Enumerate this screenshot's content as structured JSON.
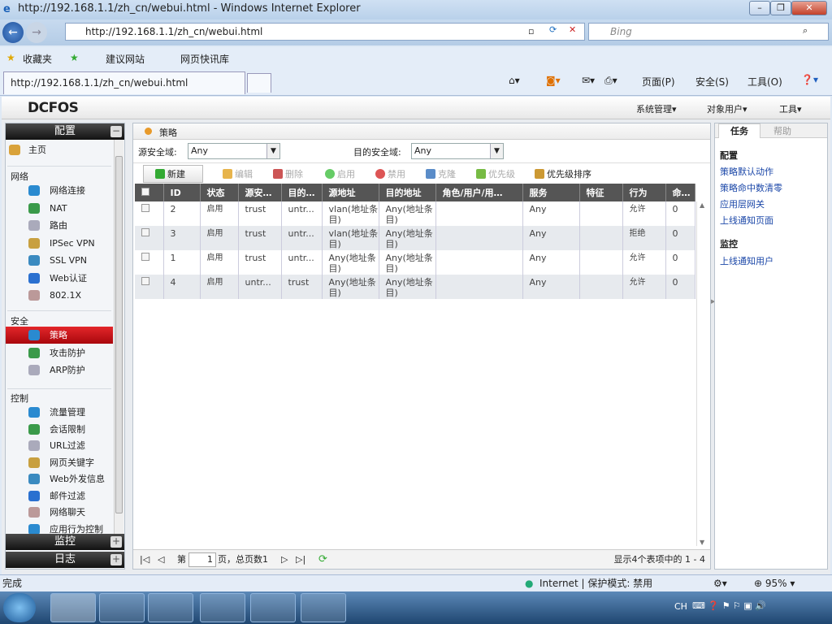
{
  "window": {
    "title": "http://192.168.1.1/zh_cn/webui.html - Windows Internet Explorer",
    "url": "http://192.168.1.1/zh_cn/webui.html",
    "search_placeholder": "Bing"
  },
  "favbar": {
    "favorites": "收藏夹",
    "suggested": "建议网站",
    "webslice": "网页快讯库"
  },
  "tab": {
    "label": "http://192.168.1.1/zh_cn/webui.html"
  },
  "commands": {
    "page": "页面(P)",
    "safety": "安全(S)",
    "tools": "工具(O)"
  },
  "app": {
    "logo": "DCFOS",
    "menus": [
      "系统管理",
      "对象用户",
      "工具"
    ]
  },
  "sidebar": {
    "config": "配置",
    "monitor": "监控",
    "log": "日志",
    "home": "主页",
    "groups": {
      "network": "网络",
      "security": "安全",
      "control": "控制"
    },
    "network": [
      "网络连接",
      "NAT",
      "路由",
      "IPSec VPN",
      "SSL VPN",
      "Web认证",
      "802.1X"
    ],
    "security": [
      "策略",
      "攻击防护",
      "ARP防护"
    ],
    "control": [
      "流量管理",
      "会话限制",
      "URL过滤",
      "网页关键字",
      "Web外发信息",
      "邮件过滤",
      "网络聊天",
      "应用行为控制"
    ]
  },
  "main": {
    "breadcrumb": "策略",
    "src_zone_label": "源安全域:",
    "src_zone": "Any",
    "dst_zone_label": "目的安全域:",
    "dst_zone": "Any",
    "toolbar": [
      "新建",
      "编辑",
      "删除",
      "启用",
      "禁用",
      "克隆",
      "优先级",
      "优先级排序"
    ],
    "columns": [
      "ID",
      "状态",
      "源安…",
      "目的…",
      "源地址",
      "目的地址",
      "角色/用户/用…",
      "服务",
      "特征",
      "行为",
      "命…"
    ],
    "rows": [
      [
        "2",
        "启用",
        "trust",
        "untr...",
        "vlan(地址条目)",
        "Any(地址条目)",
        "",
        "Any",
        "",
        "允许",
        "0"
      ],
      [
        "3",
        "启用",
        "trust",
        "untr...",
        "vlan(地址条目)",
        "Any(地址条目)",
        "",
        "Any",
        "",
        "拒绝",
        "0"
      ],
      [
        "1",
        "启用",
        "trust",
        "untr...",
        "Any(地址条目)",
        "Any(地址条目)",
        "",
        "Any",
        "",
        "允许",
        "0"
      ],
      [
        "4",
        "启用",
        "untr...",
        "trust",
        "Any(地址条目)",
        "Any(地址条目)",
        "",
        "Any",
        "",
        "允许",
        "0"
      ]
    ],
    "pager": {
      "page_prefix": "第",
      "page": "1",
      "page_suffix": "页，总页数1",
      "summary": "显示4个表项中的 1 - 4"
    }
  },
  "right": {
    "tabs": [
      "任务",
      "帮助"
    ],
    "config_title": "配置",
    "config_links": [
      "策略默认动作",
      "策略命中数清零",
      "应用层网关",
      "上线通知页面"
    ],
    "monitor_title": "监控",
    "monitor_links": [
      "上线通知用户"
    ]
  },
  "status": {
    "left": "完成",
    "zone": "Internet | 保护模式: 禁用",
    "zoom": "95%",
    "lang": "CH"
  }
}
